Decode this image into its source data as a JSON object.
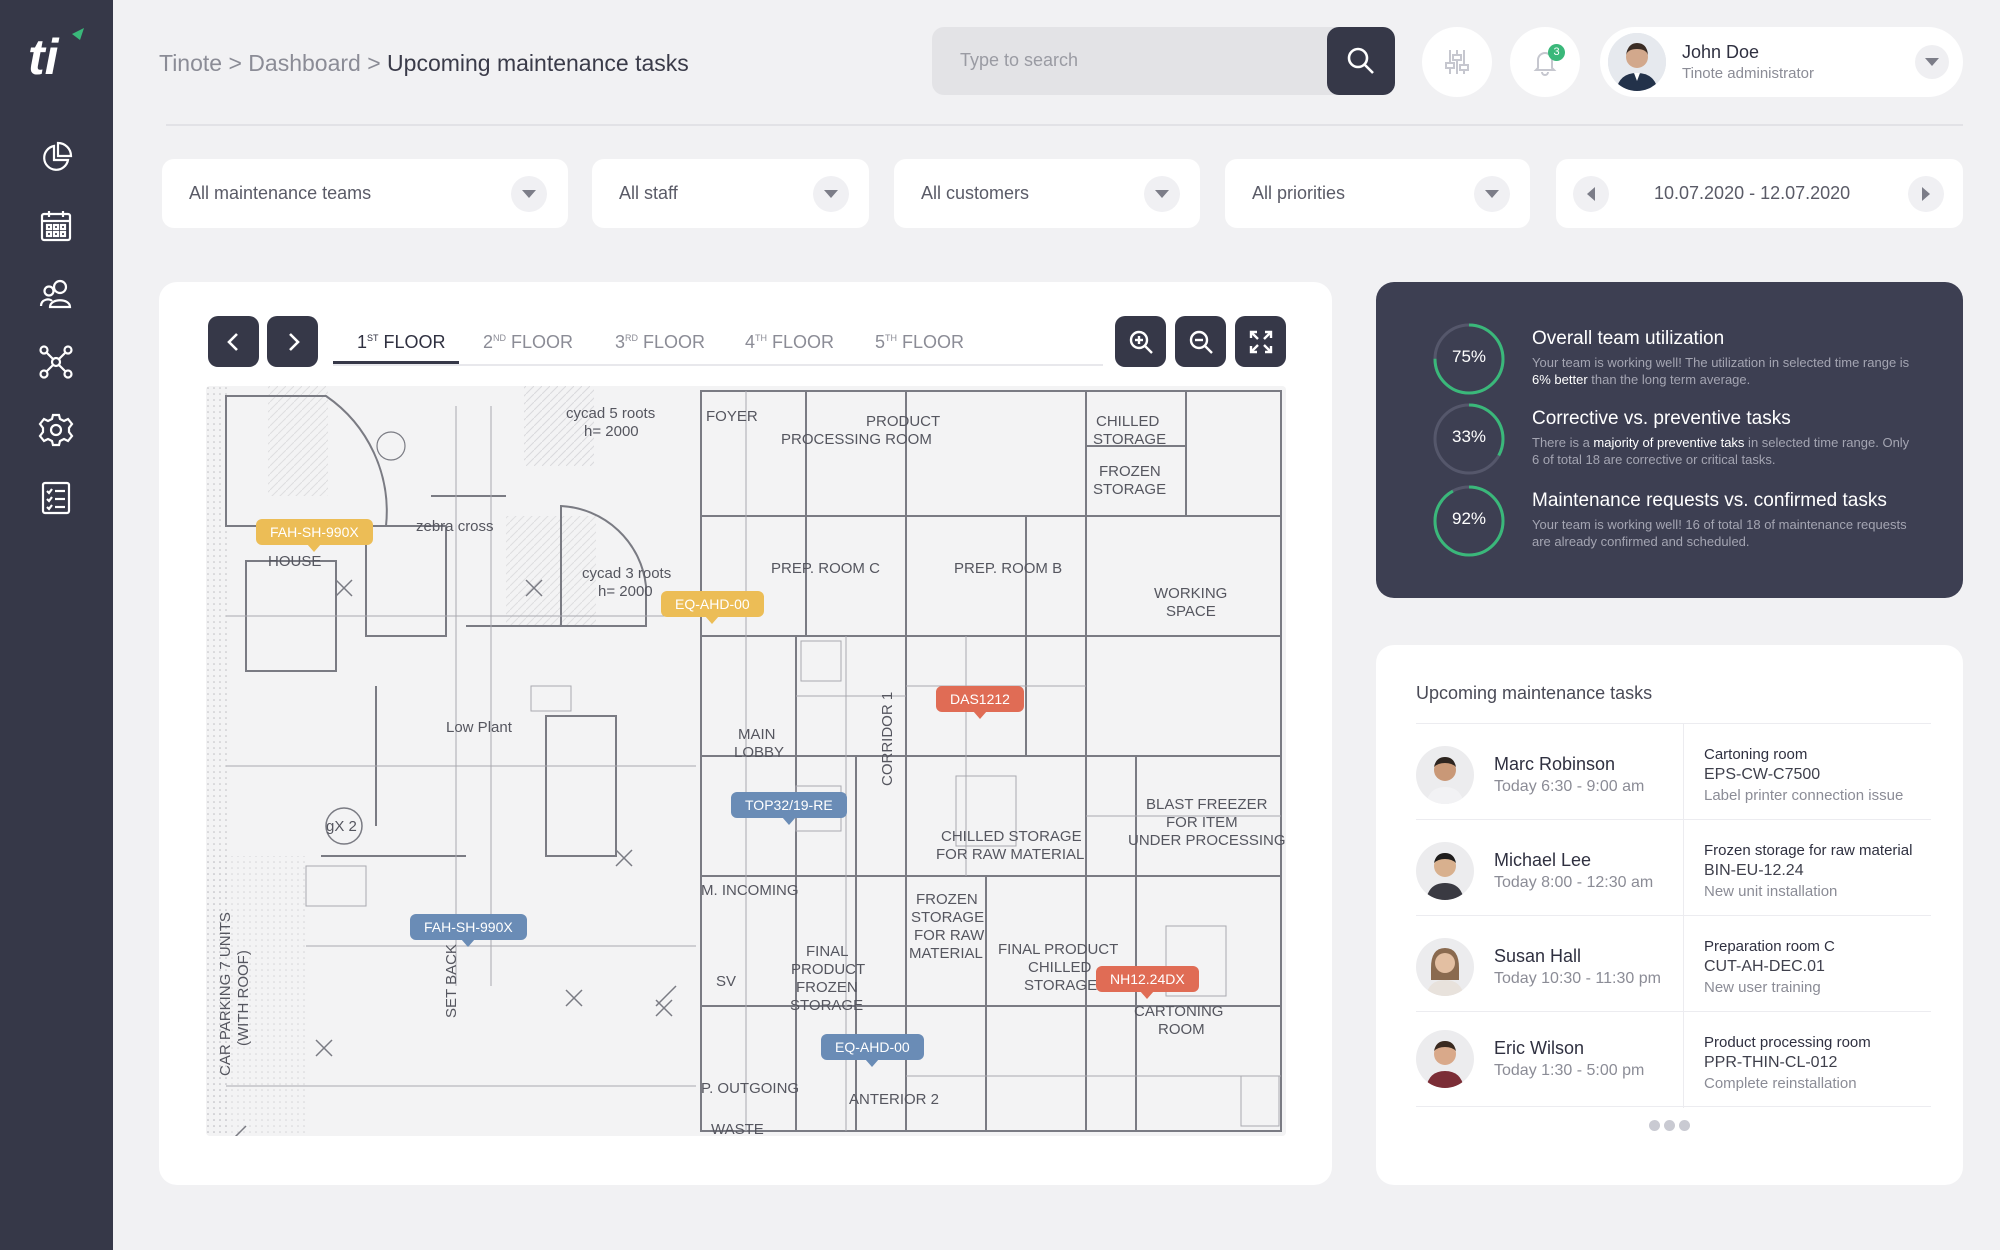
{
  "app": {
    "logo_text": "ti"
  },
  "breadcrumb": {
    "root": "Tinote",
    "sep1": " > ",
    "parent": "Dashboard",
    "sep2": " > ",
    "current": "Upcoming maintenance tasks"
  },
  "search": {
    "placeholder": "Type to search"
  },
  "notifications": {
    "count": "3"
  },
  "user": {
    "name": "John Doe",
    "role": "Tinote administrator"
  },
  "filters": {
    "teams": "All maintenance teams",
    "staff": "All staff",
    "customers": "All customers",
    "priorities": "All priorities",
    "date_range": "10.07.2020 - 12.07.2020"
  },
  "floors": [
    {
      "num": "1",
      "sup": "ST",
      "word": " FLOOR"
    },
    {
      "num": "2",
      "sup": "ND",
      "word": " FLOOR"
    },
    {
      "num": "3",
      "sup": "RD",
      "word": " FLOOR"
    },
    {
      "num": "4",
      "sup": "TH",
      "word": " FLOOR"
    },
    {
      "num": "5",
      "sup": "TH",
      "word": " FLOOR"
    }
  ],
  "plan_labels": {
    "product_processing": "PRODUCT",
    "product_processing2": "PROCESSING ROOM",
    "chilled_storage": "CHILLED",
    "chilled_storage2": "STORAGE",
    "frozen_storage": "FROZEN",
    "frozen_storage2": "STORAGE",
    "prep_c": "PREP. ROOM C",
    "prep_b": "PREP. ROOM B",
    "working_space": "WORKING",
    "working_space2": "SPACE",
    "house": "HOUSE",
    "zebra": "zebra cross",
    "main_lobby": "MAIN",
    "main_lobby2": "LOBBY",
    "corridor": "CORRIDOR 1",
    "blast": "BLAST FREEZER",
    "blast2": "FOR ITEM",
    "blast3": "UNDER PROCESSING",
    "chilled_raw": "CHILLED STORAGE",
    "chilled_raw2": "FOR RAW MATERIAL",
    "frozen_raw": "FROZEN",
    "frozen_raw2": "STORAGE",
    "frozen_raw3": "FOR RAW",
    "frozen_raw4": "MATERIAL",
    "final_frozen": "FINAL",
    "final_frozen2": "PRODUCT",
    "final_frozen3": "FROZEN",
    "final_frozen4": "STORAGE",
    "final_chilled": "FINAL PRODUCT",
    "final_chilled2": "CHILLED",
    "final_chilled3": "STORAGE",
    "cartoning": "CARTONING",
    "cartoning2": "ROOM",
    "anterior": "ANTERIOR 2",
    "outgoing": "P. OUTGOING",
    "incoming": "M. INCOMING",
    "low_plant": "Low Plant",
    "car_parking": "CAR PARKING 7 UNITS",
    "car_parking2": "(WITH ROOF)",
    "set_back": "SET BACK",
    "cycad5": "cycad 5 roots",
    "cycad5b": "h= 2000",
    "cycad3": "cycad 3 roots",
    "cycad3b": "h= 2000",
    "foyer": "FOYER",
    "sv": "SV",
    "waste": "WASTE",
    "gx2": "gX 2"
  },
  "markers": [
    {
      "id": "FAH-SH-990X",
      "color": "yellow"
    },
    {
      "id": "EQ-AHD-00",
      "color": "yellow"
    },
    {
      "id": "DAS1212",
      "color": "red"
    },
    {
      "id": "TOP32/19-RE",
      "color": "blue"
    },
    {
      "id": "FAH-SH-990X",
      "color": "blue"
    },
    {
      "id": "NH12.24DX",
      "color": "red"
    },
    {
      "id": "EQ-AHD-00",
      "color": "blue"
    }
  ],
  "marker_colors": {
    "yellow": "#ecbd56",
    "blue": "#6a8cb6",
    "red": "#e06c55"
  },
  "stats": [
    {
      "value": 75,
      "label": "75%",
      "title": "Overall team utilization",
      "desc_a": "Your team is working well! The utilization in selected time range is ",
      "desc_b": "6% better",
      "desc_c": " than the long term average."
    },
    {
      "value": 33,
      "label": "33%",
      "title": "Corrective vs. preventive tasks",
      "desc_a": "There is a ",
      "desc_b": "majority of preventive taks",
      "desc_c": " in selected time range. Only 6 of total 18 are corrective or critical tasks."
    },
    {
      "value": 92,
      "label": "92%",
      "title": "Maintenance requests vs. confirmed tasks",
      "desc_a": "Your team is working well! 16 of total 18 of maintenance requests are already confirmed and scheduled.",
      "desc_b": "",
      "desc_c": ""
    }
  ],
  "tasks_panel": {
    "title": "Upcoming maintenance tasks",
    "items": [
      {
        "name": "Marc Robinson",
        "time": "Today 6:30 - 9:00 am",
        "room": "Cartoning room",
        "code": "EPS-CW-C7500",
        "issue": "Label printer connection issue"
      },
      {
        "name": "Michael Lee",
        "time": "Today 8:00 - 12:30 am",
        "room": "Frozen storage for raw material",
        "code": "BIN-EU-12.24",
        "issue": "New unit installation"
      },
      {
        "name": "Susan Hall",
        "time": "Today 10:30 - 11:30 pm",
        "room": "Preparation room C",
        "code": "CUT-AH-DEC.01",
        "issue": "New user training"
      },
      {
        "name": "Eric Wilson",
        "time": "Today 1:30 - 5:00 pm",
        "room": "Product processing room",
        "code": "PPR-THIN-CL-012",
        "issue": "Complete reinstallation"
      }
    ]
  },
  "colors": {
    "sidebar": "#363848",
    "accent_green": "#3ab87a",
    "stats_bg": "#3d3f52"
  }
}
